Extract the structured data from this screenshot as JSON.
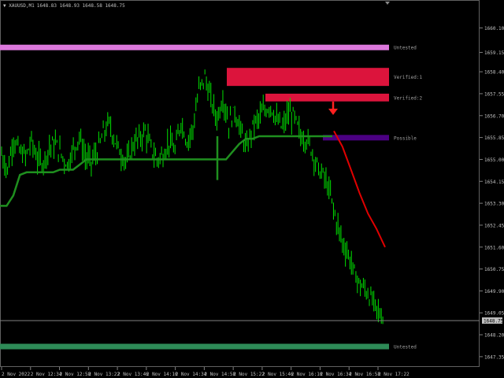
{
  "header": {
    "symbol": "XAUUSD,M1",
    "ohlc": "1648.83 1648.93 1648.58 1648.75"
  },
  "colors": {
    "background": "#000000",
    "candles": "#00e000",
    "moving_average": "#1f8f1f",
    "forecast": "#e00000",
    "zone_untested_top": "#dc78dc",
    "zone_verified": "#dc143c",
    "zone_possible": "#4b0082",
    "zone_untested_bottom": "#2e8b57",
    "grid_text": "#c0c0c0"
  },
  "zones": [
    {
      "label": "Untested",
      "kind": "untested-top",
      "price_top": 1659.45,
      "price_bottom": 1659.25
    },
    {
      "label": "Verified:1",
      "kind": "verified",
      "price_top": 1658.55,
      "price_bottom": 1657.85
    },
    {
      "label": "Verified:2",
      "kind": "verified",
      "price_top": 1657.55,
      "price_bottom": 1657.25
    },
    {
      "label": "Possible",
      "kind": "possible",
      "price_top": 1655.95,
      "price_bottom": 1655.75
    },
    {
      "label": "Untested",
      "kind": "untested-bottom",
      "price_top": 1647.85,
      "price_bottom": 1647.65
    }
  ],
  "price_axis": {
    "ticks": [
      "1660.10",
      "1659.15",
      "1658.40",
      "1657.55",
      "1656.70",
      "1655.85",
      "1655.00",
      "1654.15",
      "1653.30",
      "1652.45",
      "1651.60",
      "1650.75",
      "1649.90",
      "1649.05",
      "1648.20",
      "1647.35"
    ],
    "current_price": "1648.75"
  },
  "time_axis": {
    "ticks": [
      "2 Nov 2022",
      "2 Nov 12:34",
      "2 Nov 12:58",
      "2 Nov 13:22",
      "2 Nov 13:46",
      "2 Nov 14:10",
      "2 Nov 14:34",
      "2 Nov 14:58",
      "2 Nov 15:22",
      "2 Nov 15:46",
      "2 Nov 16:10",
      "2 Nov 16:34",
      "2 Nov 16:58",
      "2 Nov 17:22"
    ]
  },
  "chart_data": {
    "type": "line",
    "title": "XAUUSD,M1",
    "xlabel": "",
    "ylabel": "",
    "ylim": [
      1647.0,
      1660.6
    ],
    "series": [
      {
        "values": [
          1655.2,
          1654.6,
          1655.8,
          1655.3,
          1655.1,
          1655.7,
          1655.0,
          1654.9,
          1655.5,
          1655.6,
          1655.2,
          1654.8,
          1655.4,
          1655.9,
          1655.1,
          1654.9,
          1655.3,
          1656.0,
          1656.4,
          1655.7,
          1655.2,
          1654.9,
          1655.6,
          1655.8,
          1656.1,
          1655.4,
          1655.0,
          1655.2,
          1655.7,
          1655.3,
          1656.5,
          1655.7,
          1656.2,
          1657.7,
          1658.2,
          1657.3,
          1656.6,
          1657.4,
          1656.4,
          1656.9,
          1656.1,
          1655.4,
          1656.3,
          1656.6,
          1656.9,
          1657.1,
          1656.5,
          1656.2,
          1656.8,
          1656.6,
          1655.9,
          1655.8,
          1655.3,
          1654.6,
          1654.3,
          1653.6,
          1652.6,
          1651.8,
          1651.3,
          1650.6,
          1650.1,
          1649.9,
          1649.5,
          1649.1,
          1648.8
        ],
        "x_range": [
          "2 Nov 2022",
          "2 Nov 17:22"
        ]
      },
      {
        "values": [
          1653.2,
          1653.2,
          1653.6,
          1654.4,
          1654.5,
          1654.5,
          1654.5,
          1654.5,
          1654.5,
          1654.6,
          1654.6,
          1654.6,
          1654.8,
          1655.0,
          1655.0,
          1655.0,
          1655.0,
          1655.0,
          1655.0,
          1655.0,
          1655.0,
          1655.0,
          1655.0,
          1655.0,
          1655.0,
          1655.0,
          1655.0,
          1655.0,
          1655.0,
          1655.0,
          1655.0,
          1655.0,
          1655.0,
          1655.0,
          1655.0,
          1655.3,
          1655.6,
          1655.8,
          1655.8,
          1655.9,
          1655.9,
          1655.9,
          1655.9,
          1655.9,
          1655.9,
          1655.9,
          1655.9,
          1655.9,
          1655.9,
          1655.9,
          1655.9
        ]
      },
      {
        "values": [
          1656.1,
          1655.5,
          1654.6,
          1653.7,
          1652.9,
          1652.3,
          1651.6
        ]
      }
    ]
  }
}
